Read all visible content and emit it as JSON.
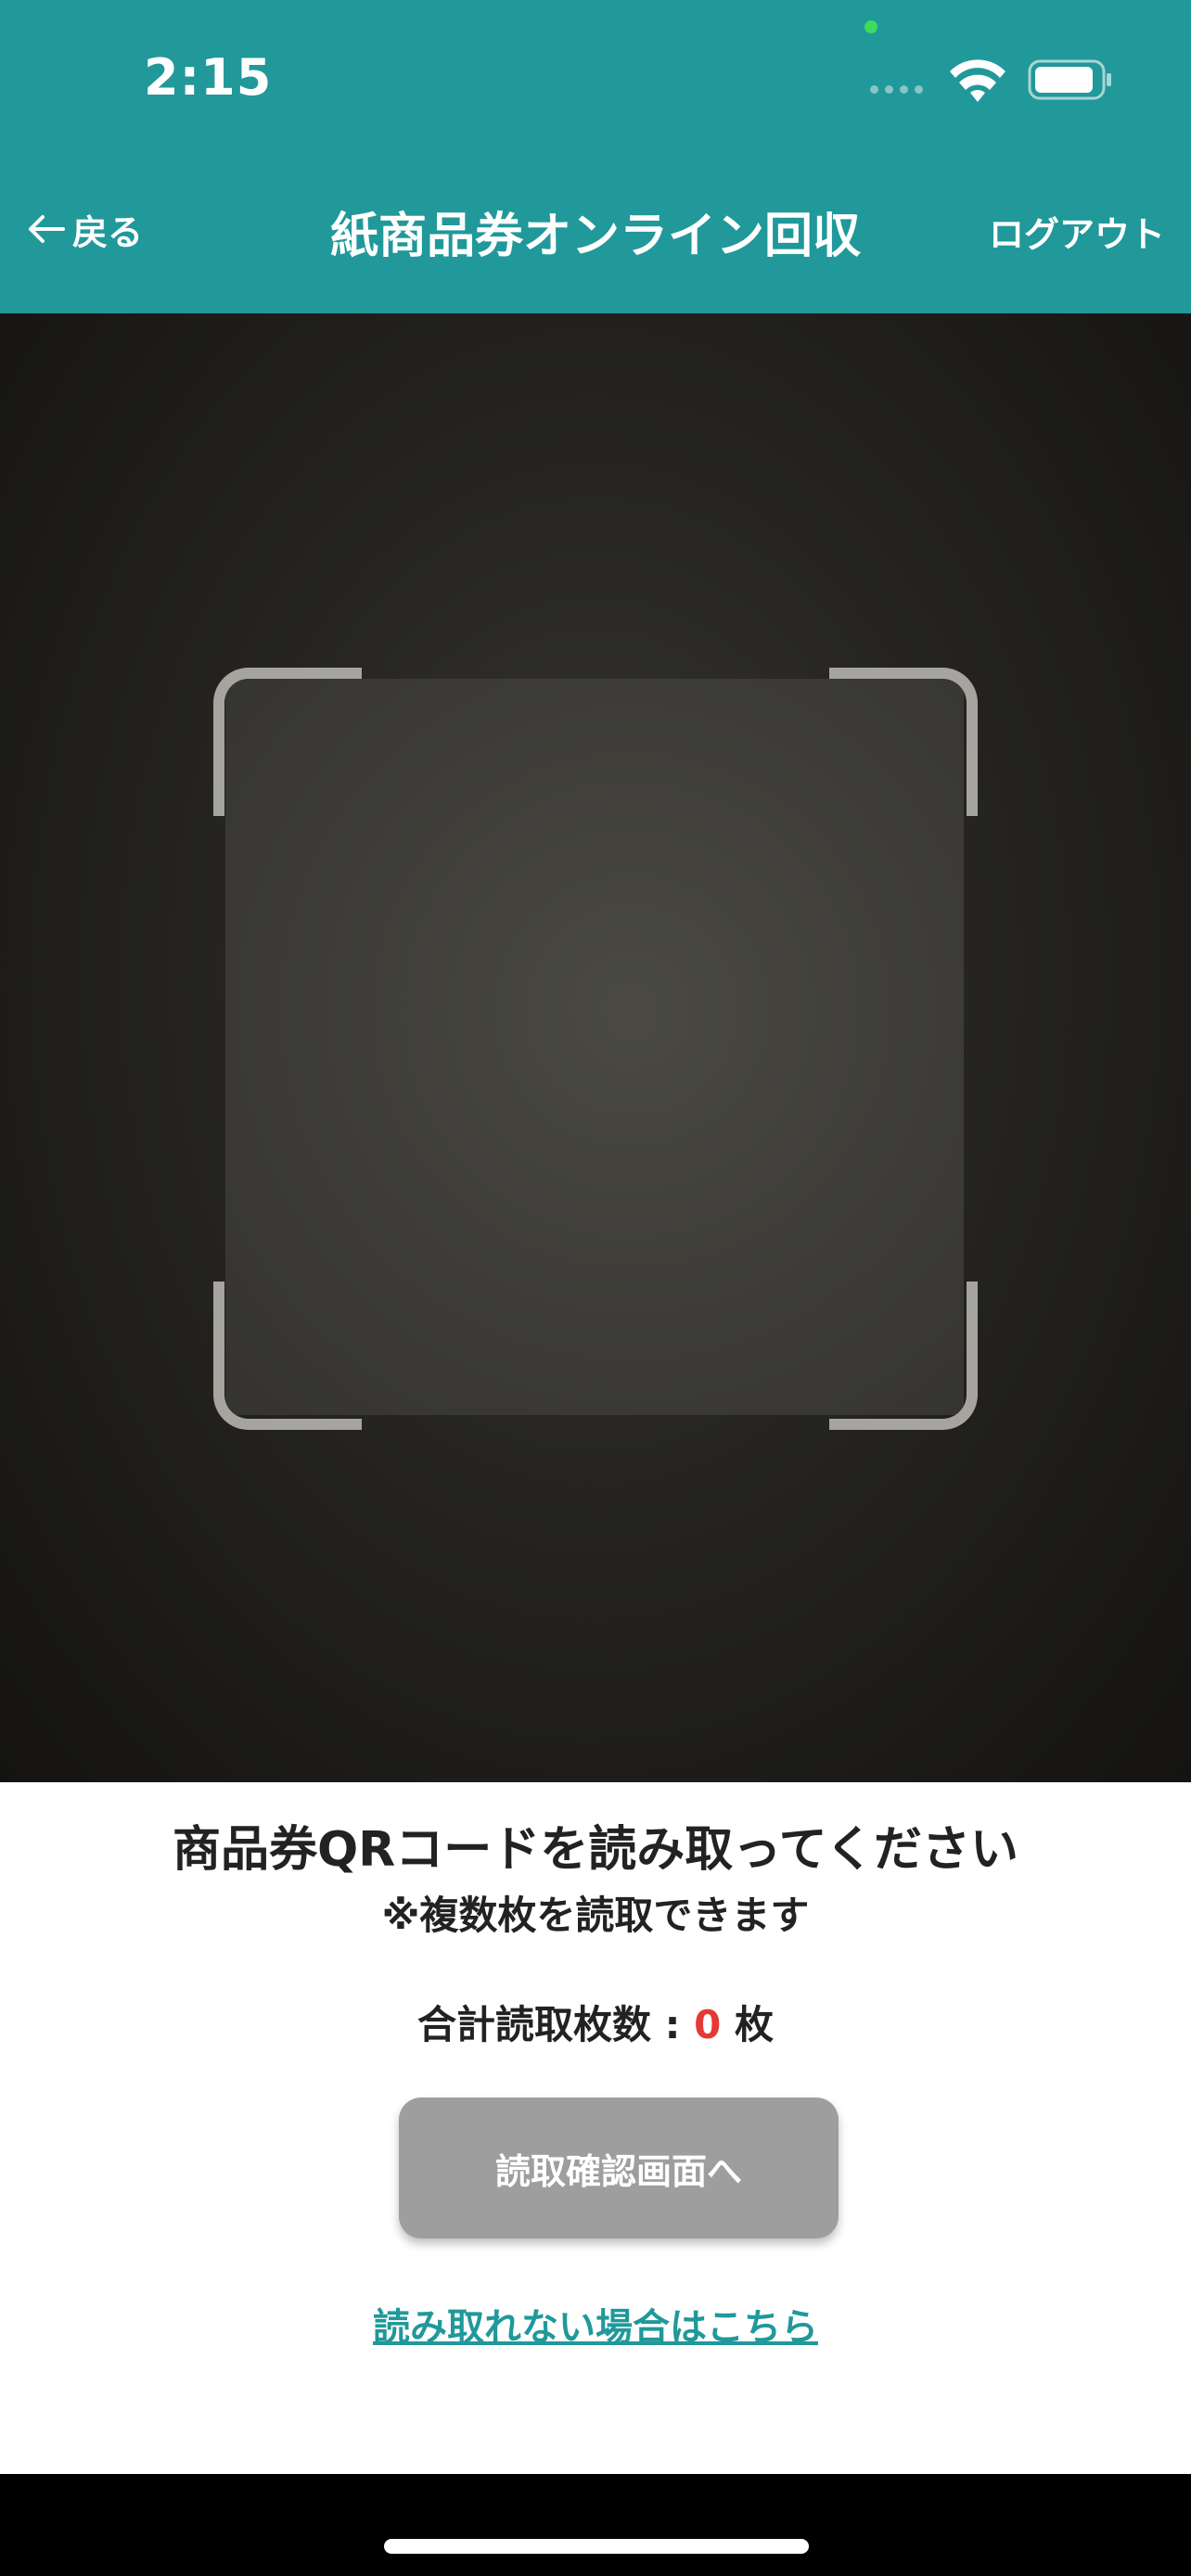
{
  "status_bar": {
    "time": "2:15"
  },
  "nav": {
    "back_label": "戻る",
    "title": "紙商品券オンライン回収",
    "logout_label": "ログアウト"
  },
  "scanner": {
    "instruction": "商品券QRコードを読み取ってください",
    "note": "※複数枚を読取できます",
    "count_label": "合計読取枚数 : ",
    "count_value": "0",
    "count_unit": " 枚",
    "confirm_button": "読取確認画面へ",
    "help_link": "読み取れない場合はこちら"
  },
  "colors": {
    "header": "#21989a",
    "count_value": "#e53935",
    "disabled_button": "#9e9e9e",
    "link": "#21989a"
  },
  "icons": {
    "back": "arrow-left-icon",
    "wifi": "wifi-icon",
    "battery": "battery-icon",
    "signal": "cellular-signal-icon"
  }
}
